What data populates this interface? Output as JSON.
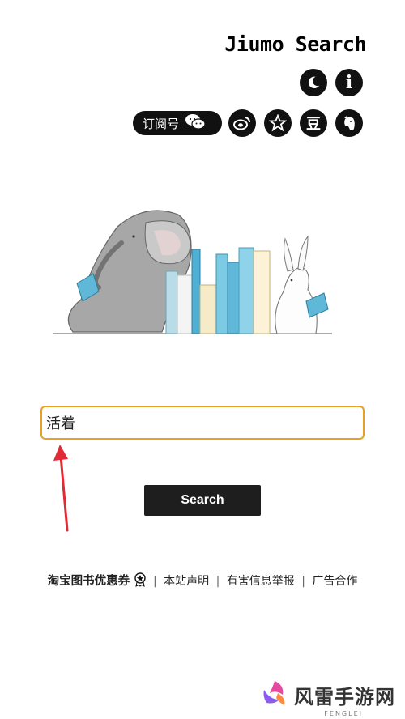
{
  "header": {
    "logo_text": "Jiumo Search",
    "subscription_label": "订阅号",
    "icons": [
      "moon-icon",
      "info-icon",
      "wechat-icon",
      "weibo-icon",
      "star-icon",
      "douban-icon",
      "evernote-icon"
    ],
    "douban_label": "豆",
    "info_label": "i"
  },
  "search": {
    "value": "活着",
    "button_label": "Search"
  },
  "footer": {
    "coupon_link": "淘宝图书优惠券",
    "sep1": "|",
    "statement_link": "本站声明",
    "sep2": "|",
    "report_link": "有害信息举报",
    "sep3": "|",
    "ad_link": "广告合作"
  },
  "watermark": {
    "brand": "风雷手游网",
    "sub": "FENGLEI"
  },
  "colors": {
    "search_border": "#e6a023",
    "button_bg": "#1e1e1e",
    "arrow": "#e02a35"
  }
}
